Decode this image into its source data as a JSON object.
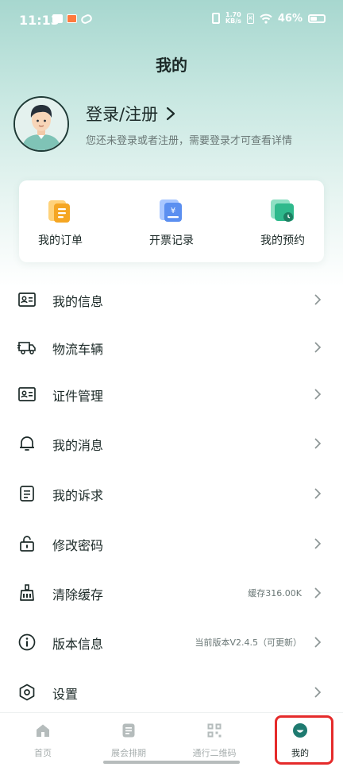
{
  "status_bar": {
    "time": "11:13",
    "net_speed_value": "1.70",
    "net_speed_unit": "KB/s",
    "battery": "46%",
    "icons": [
      "mail-icon",
      "app-notification-icon",
      "app-notification-icon-2",
      "vibrate-icon",
      "sim-icon",
      "wifi-icon",
      "battery-icon"
    ]
  },
  "page_title": "我的",
  "profile": {
    "login_title": "登录/注册",
    "login_arrow": "›",
    "subtitle": "您还未登录或者注册，需要登录才可查看详情"
  },
  "quick_actions": [
    {
      "label": "我的订单",
      "icon": "order-icon"
    },
    {
      "label": "开票记录",
      "icon": "invoice-icon"
    },
    {
      "label": "我的预约",
      "icon": "appointment-icon"
    }
  ],
  "menu": [
    {
      "label": "我的信息",
      "icon": "id-card-icon",
      "right_text": ""
    },
    {
      "label": "物流车辆",
      "icon": "truck-icon",
      "right_text": ""
    },
    {
      "label": "证件管理",
      "icon": "id-card-icon",
      "right_text": ""
    },
    {
      "label": "我的消息",
      "icon": "bell-icon",
      "right_text": ""
    },
    {
      "label": "我的诉求",
      "icon": "document-icon",
      "right_text": ""
    },
    {
      "label": "修改密码",
      "icon": "lock-icon",
      "right_text": ""
    },
    {
      "label": "清除缓存",
      "icon": "broom-icon",
      "right_text": "缓存316.00K"
    },
    {
      "label": "版本信息",
      "icon": "info-icon",
      "right_text": "当前版本V2.4.5（可更新）"
    },
    {
      "label": "设置",
      "icon": "settings-icon",
      "right_text": ""
    }
  ],
  "bottom_nav": [
    {
      "label": "首页",
      "icon": "home-icon",
      "active": false
    },
    {
      "label": "展会排期",
      "icon": "schedule-icon",
      "active": false
    },
    {
      "label": "通行二维码",
      "icon": "qrcode-icon",
      "active": false
    },
    {
      "label": "我的",
      "icon": "profile-icon",
      "active": true
    }
  ],
  "colors": {
    "accent": "#1e7a70",
    "header_gradient_top": "#a7d7cf",
    "text_primary": "#1c2a28",
    "text_secondary": "#6a7776",
    "tab_inactive": "#a7aeae",
    "highlight": "#e52b2b"
  }
}
